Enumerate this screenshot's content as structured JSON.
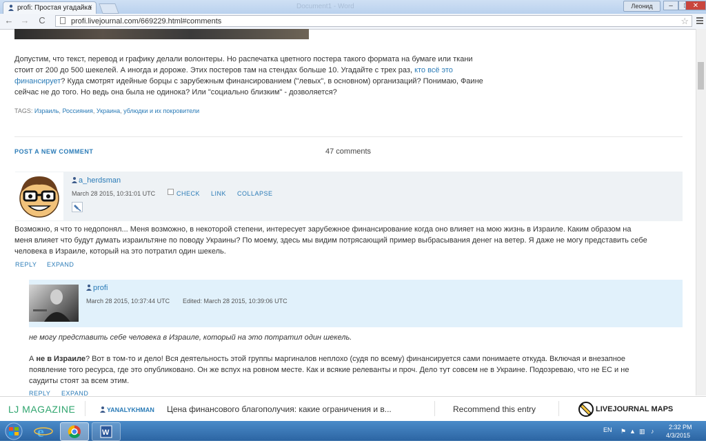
{
  "browser": {
    "tab_title": "profi: Простая угадайка",
    "tab_close": "×",
    "ghost_title": "Document1 - Word",
    "user_button": "Леонид",
    "win_min": "–",
    "win_max": "□",
    "win_close": "✕",
    "back": "←",
    "forward": "→",
    "reload": "C",
    "url": "profi.livejournal.com/669229.html#comments",
    "star": "☆"
  },
  "post": {
    "text_line1": "Допустим, что текст, перевод и графику делали волонтеры. Но распечатка цветного постера такого формата на бумаге или ткани",
    "text_line2_a": "стоит от 200 до 500 шекелей. А иногда и дороже. Этих постеров там на стендах больше 10. Угадайте с трех раз, ",
    "text_line2_link": "кто всё это",
    "text_line3_link": "финансирует",
    "text_line3_b": "? Куда смотрят идейные борцы с зарубежным финансированием (\"левых\", в основном) организаций? Понимаю, Фаине",
    "text_line4": "сейчас не до того. Но ведь она была не одинока? Или \"социально близким\" - дозволяется?",
    "tags_label": "TAGS: ",
    "tags": [
      "Израиль",
      "Россияния",
      "Украина",
      "ублюдки и их покровители"
    ],
    "tag_sep": ", "
  },
  "comments_header": {
    "post_new": "POST A NEW COMMENT",
    "count": "47 comments"
  },
  "comment1": {
    "user": "a_herdsman",
    "date": "March 28 2015, 10:31:01 UTC",
    "check": "CHECK",
    "link": "LINK",
    "collapse": "COLLAPSE",
    "line1": "Возможно, я что то недопонял... Меня возможно, в некоторой степени, интересует зарубежное финансирование когда оно влияет на мою жизнь в Израиле. Каким образом на",
    "line2": "меня влияет что будут думать израильтяне по поводу Украины? По моему, здесь мы видим потрясающий пример выбрасывания денег на ветер. Я даже не могу представить себе",
    "line3": "человека в Израиле, который на это потратил один шекель.",
    "reply": "REPLY",
    "expand": "EXPAND"
  },
  "comment2": {
    "user": "profi",
    "date": "March 28 2015, 10:37:44 UTC",
    "edited": "Edited:  March 28 2015, 10:39:06 UTC",
    "quote": "не могу представить себе человека в Израиле, который на это потратил один шекель.",
    "p_a": "А ",
    "p_bold": "не в Израиле",
    "p_b": "? Вот в том-то и дело! Вся деятельность этой группы маргиналов неплохо (судя по всему) финансируется сами понимаете откуда. Включая и внезапное",
    "line2": "появление того ресурса, где это опубликовано. Он же вспух на ровном месте. Как и всякие релеванты и проч. Дело тут совсем не в Украине. Подозреваю, что не ЕС и не",
    "line3": "саудиты стоят за всем этим.",
    "reply": "REPLY",
    "expand": "EXPAND"
  },
  "ljbar": {
    "magazine": "LJ MAGAZINE",
    "user": "YANALYKHMAN",
    "headline": "Цена финансового благополучия: какие ограничения и в...",
    "recommend": "Recommend this entry",
    "maps": "LIVEJOURNAL MAPS"
  },
  "taskbar": {
    "lang": "EN",
    "time": "2:32 PM",
    "date": "4/3/2015"
  },
  "colors": {
    "link": "#2a7bb7",
    "lj_green": "#2fa56e",
    "comment_head": "#eef2f5",
    "reply_head": "#e1f1fb"
  }
}
